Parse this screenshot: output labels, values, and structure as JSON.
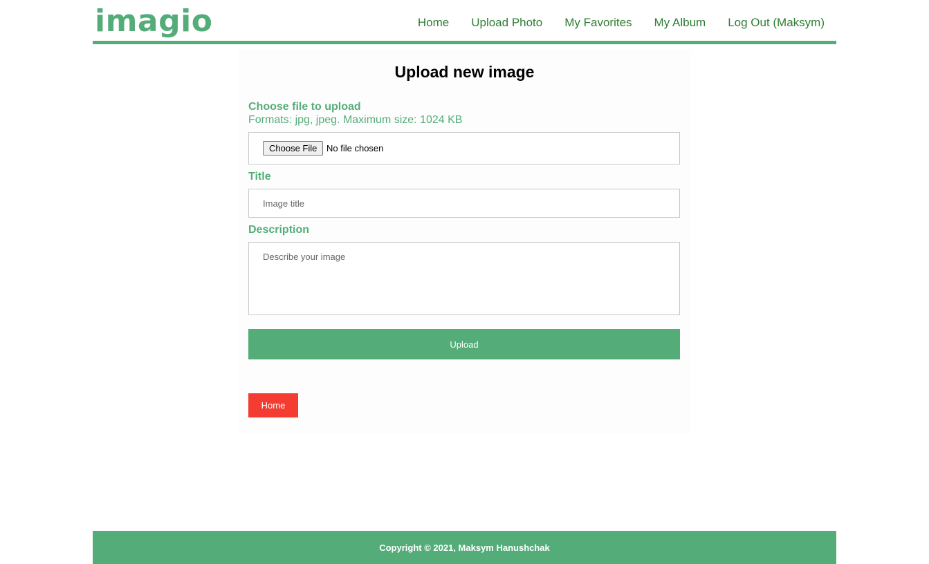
{
  "header": {
    "logo": "imagio",
    "nav": [
      {
        "label": "Home"
      },
      {
        "label": "Upload Photo"
      },
      {
        "label": "My Favorites"
      },
      {
        "label": "My Album"
      },
      {
        "label": "Log Out (Maksym)"
      }
    ]
  },
  "form": {
    "title": "Upload new image",
    "file_label": "Choose file to upload",
    "file_hint": "Formats: jpg, jpeg. Maximum size: 1024 KB",
    "file_button": "Choose File",
    "file_status": "No file chosen",
    "title_label": "Title",
    "title_placeholder": "Image title",
    "description_label": "Description",
    "description_placeholder": "Describe your image",
    "upload_button": "Upload",
    "home_button": "Home"
  },
  "footer": {
    "copyright": "Copyright © 2021, Maksym Hanushchak"
  },
  "colors": {
    "accent": "#54ad79",
    "nav_text": "#2e7d32",
    "home_button": "#f33d33"
  }
}
